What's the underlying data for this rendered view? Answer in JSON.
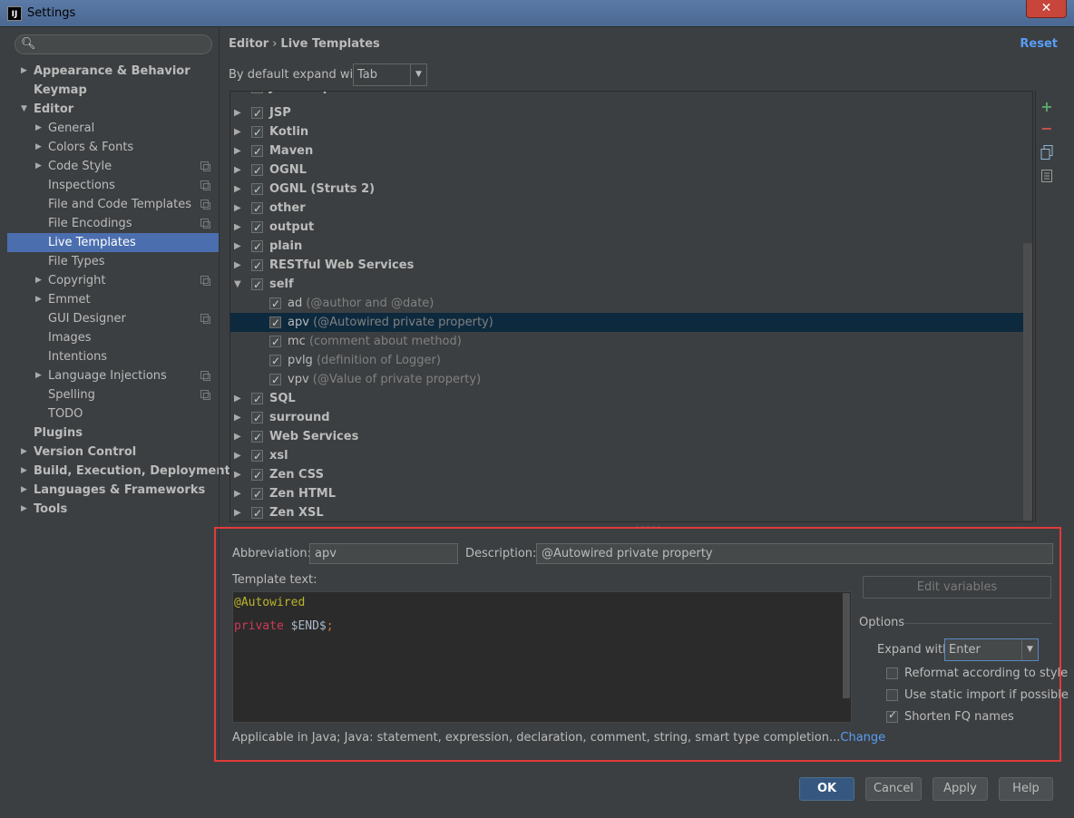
{
  "window": {
    "title": "Settings",
    "app_icon": "IJ"
  },
  "sidebar": {
    "items": [
      {
        "label": "Appearance & Behavior",
        "bold": true,
        "arrow": "right",
        "level": 0
      },
      {
        "label": "Keymap",
        "bold": true,
        "arrow": "",
        "level": 0
      },
      {
        "label": "Editor",
        "bold": true,
        "arrow": "down",
        "level": 0
      },
      {
        "label": "General",
        "arrow": "right",
        "level": 1
      },
      {
        "label": "Colors & Fonts",
        "arrow": "right",
        "level": 1
      },
      {
        "label": "Code Style",
        "arrow": "right",
        "level": 1,
        "project": true
      },
      {
        "label": "Inspections",
        "level": 1,
        "project": true
      },
      {
        "label": "File and Code Templates",
        "level": 1,
        "project": true
      },
      {
        "label": "File Encodings",
        "level": 1,
        "project": true
      },
      {
        "label": "Live Templates",
        "level": 1,
        "selected": true
      },
      {
        "label": "File Types",
        "level": 1
      },
      {
        "label": "Copyright",
        "arrow": "right",
        "level": 1,
        "project": true
      },
      {
        "label": "Emmet",
        "arrow": "right",
        "level": 1
      },
      {
        "label": "GUI Designer",
        "level": 1,
        "project": true
      },
      {
        "label": "Images",
        "level": 1
      },
      {
        "label": "Intentions",
        "level": 1
      },
      {
        "label": "Language Injections",
        "arrow": "right",
        "level": 1,
        "project": true
      },
      {
        "label": "Spelling",
        "level": 1,
        "project": true
      },
      {
        "label": "TODO",
        "level": 1
      },
      {
        "label": "Plugins",
        "bold": true,
        "level": 0
      },
      {
        "label": "Version Control",
        "bold": true,
        "arrow": "right",
        "level": 0
      },
      {
        "label": "Build, Execution, Deployment",
        "bold": true,
        "arrow": "right",
        "level": 0
      },
      {
        "label": "Languages & Frameworks",
        "bold": true,
        "arrow": "right",
        "level": 0
      },
      {
        "label": "Tools",
        "bold": true,
        "arrow": "right",
        "level": 0
      }
    ]
  },
  "header": {
    "breadcrumb_parent": "Editor",
    "breadcrumb_sep": "›",
    "breadcrumb_current": "Live Templates",
    "reset_label": "Reset",
    "expand_label": "By default expand with",
    "expand_value": "Tab"
  },
  "tree": {
    "rows": [
      {
        "label": "JavaScript",
        "checked": true,
        "arrow": "right",
        "partial": true
      },
      {
        "label": "JSP",
        "checked": true,
        "arrow": "right"
      },
      {
        "label": "Kotlin",
        "checked": true,
        "arrow": "right"
      },
      {
        "label": "Maven",
        "checked": true,
        "arrow": "right"
      },
      {
        "label": "OGNL",
        "checked": true,
        "arrow": "right"
      },
      {
        "label": "OGNL (Struts 2)",
        "checked": true,
        "arrow": "right"
      },
      {
        "label": "other",
        "checked": true,
        "arrow": "right"
      },
      {
        "label": "output",
        "checked": true,
        "arrow": "right"
      },
      {
        "label": "plain",
        "checked": true,
        "arrow": "right"
      },
      {
        "label": "RESTful Web Services",
        "checked": true,
        "arrow": "right"
      },
      {
        "label": "self",
        "checked": true,
        "arrow": "down"
      },
      {
        "label": "ad",
        "desc": "(@author and @date)",
        "checked": true,
        "child": true
      },
      {
        "label": "apv",
        "desc": "(@Autowired private property)",
        "checked": true,
        "child": true,
        "selected": true
      },
      {
        "label": "mc",
        "desc": "(comment about method)",
        "checked": true,
        "child": true
      },
      {
        "label": "pvlg",
        "desc": "(definition of Logger)",
        "checked": true,
        "child": true
      },
      {
        "label": "vpv",
        "desc": "(@Value of private property)",
        "checked": true,
        "child": true
      },
      {
        "label": "SQL",
        "checked": true,
        "arrow": "right"
      },
      {
        "label": "surround",
        "checked": true,
        "arrow": "right"
      },
      {
        "label": "Web Services",
        "checked": true,
        "arrow": "right"
      },
      {
        "label": "xsl",
        "checked": true,
        "arrow": "right"
      },
      {
        "label": "Zen CSS",
        "checked": true,
        "arrow": "right"
      },
      {
        "label": "Zen HTML",
        "checked": true,
        "arrow": "right"
      },
      {
        "label": "Zen XSL",
        "checked": true,
        "arrow": "right"
      }
    ],
    "toolbar": {
      "add": "+",
      "remove": "−"
    }
  },
  "editor": {
    "abbreviation_label": "Abbreviation:",
    "abbreviation_value": "apv",
    "description_label": "Description:",
    "description_value": "@Autowired private property",
    "template_label": "Template text:",
    "code_line1": "@Autowired",
    "code_kw": "private",
    "code_var": "$END$",
    "code_semi": ";",
    "edit_variables_label": "Edit variables",
    "options_title": "Options",
    "expand_with_label": "Expand with",
    "expand_with_value": "Enter",
    "reformat_label": "Reformat according to style",
    "reformat_checked": false,
    "static_import_label": "Use static import if possible",
    "static_import_checked": false,
    "shorten_label": "Shorten FQ names",
    "shorten_checked": true,
    "applicable_text": "Applicable in Java; Java: statement, expression, declaration, comment, string, smart type completion...",
    "change_link": "Change"
  },
  "footer": {
    "ok_label": "OK",
    "cancel_label": "Cancel",
    "apply_label": "Apply",
    "help_label": "Help"
  },
  "colors": {
    "background": "#3c3f41",
    "selection": "#4b6eaf",
    "tree_selection": "#0d293e",
    "highlight_border": "#e03a3a",
    "link": "#589df6"
  }
}
